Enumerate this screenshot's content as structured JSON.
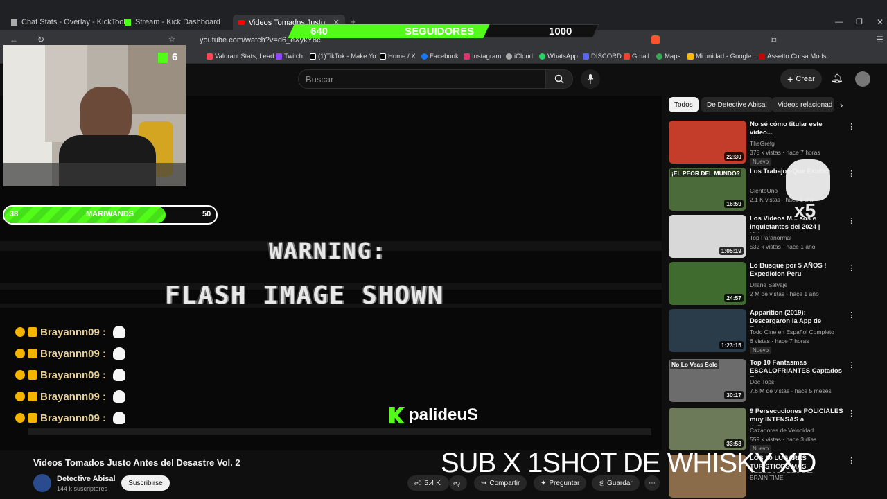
{
  "browser": {
    "tabs": [
      {
        "label": "Chat Stats - Overlay - KickTools"
      },
      {
        "label": "Stream - Kick Dashboard"
      },
      {
        "label": "Videos Tomados Justo Antes"
      }
    ],
    "url": "youtube.com/watch?v=d6_eXykY8c",
    "bookmarks": [
      "Valorant Stats, Lead...",
      "Twitch",
      "(1)TikTok - Make Yo...",
      "Home / X",
      "Facebook",
      "Instagram",
      "iCloud",
      "WhatsApp",
      "DISCORD",
      "Gmail",
      "Maps",
      "Mi unidad - Google...",
      "Assetto Corsa Mods..."
    ]
  },
  "follower_goal": {
    "current": "640",
    "label": "SEGUIDORES",
    "target": "1000",
    "progress": 0.64
  },
  "kick_badge": {
    "count": "6"
  },
  "goal_bar": {
    "start": "38",
    "label": "MARIWANDS",
    "end": "50",
    "progress": 0.76
  },
  "chat": {
    "lines": [
      "Brayannn09 :",
      "Brayannn09 :",
      "Brayannn09 :",
      "Brayannn09 :",
      "Brayannn09 :"
    ]
  },
  "video": {
    "warning_line1": "WARNING:",
    "warning_line2": "FLASH IMAGE SHOWN",
    "title": "Videos Tomados Justo Antes del Desastre Vol. 2",
    "channel": "Detective Abisal",
    "subs": "144 k suscriptores",
    "subscribe": "Suscribirse",
    "likes": "5.4 K",
    "share": "Compartir",
    "ask": "Preguntar",
    "save": "Guardar"
  },
  "youtube": {
    "search_placeholder": "Buscar",
    "create": "Crear",
    "chips": [
      "Todos",
      "De Detective Abisal",
      "Videos relacionad"
    ]
  },
  "recommendations": [
    {
      "title": "No sé cómo titular este video...",
      "channel": "TheGrefg",
      "meta": "375 k vistas · hace 7 horas",
      "duration": "22:30",
      "nuevo": "Nuevo",
      "thumb": "#c43d2a"
    },
    {
      "title": "Los Trabajos Que Existen",
      "channel": "CientoUno",
      "meta": "2.1 K vistas · hace 1 día",
      "duration": "16:59",
      "thumb": "#4b6b3a",
      "badge": "¡EL PEOR DEL MUNDO?"
    },
    {
      "title": "Los Videos M... sos e Inquietantes del 2024 | Videos...",
      "channel": "Top Paranormal",
      "meta": "532 k vistas · hace 1 año",
      "duration": "1:05:19",
      "thumb": "#d8d8d8"
    },
    {
      "title": "Lo Busque por 5 AÑOS ! Expedicion Peru",
      "channel": "Dilane Salvaje",
      "meta": "2 M de vistas · hace 1 año",
      "duration": "24:57",
      "thumb": "#3f6b2e"
    },
    {
      "title": "Apparition (2019): Descargaron la App de Fantasmas y ...",
      "channel": "Todo Cine en Español Completo",
      "meta": "6 vistas · hace 7 horas",
      "duration": "1:23:15",
      "nuevo": "Nuevo",
      "thumb": "#2a3b4a"
    },
    {
      "title": "Top 10 Fantasmas ESCALOFRIANTES Captados E...",
      "channel": "Doc Tops",
      "meta": "7.6 M de vistas · hace 5 meses",
      "duration": "30:17",
      "thumb": "#6c6c6c",
      "badge": "No Lo Veas Solo"
    },
    {
      "title": "9 Persecuciones POLICIALES muy INTENSAS a delincuentes...",
      "channel": "Cazadores de Velocidad",
      "meta": "559 k vistas · hace 3 días",
      "duration": "33:58",
      "nuevo": "Nuevo",
      "thumb": "#6d7a5a"
    },
    {
      "title": "LOS 10 LUGARES TURISTICOS MAS ATERRADORES DEL ...",
      "channel": "BRAIN TIME",
      "meta": "",
      "duration": "",
      "thumb": "#8a6b4a"
    }
  ],
  "overlays": {
    "sub_text": "SUB X 1SHOT DE WHISKY XD",
    "kick_user": "palideuS",
    "skull_multiplier": "x5"
  },
  "colors": {
    "kick_green": "#53fc18",
    "yt_bg": "#0f0f0f",
    "chrome_bg": "#202124"
  }
}
